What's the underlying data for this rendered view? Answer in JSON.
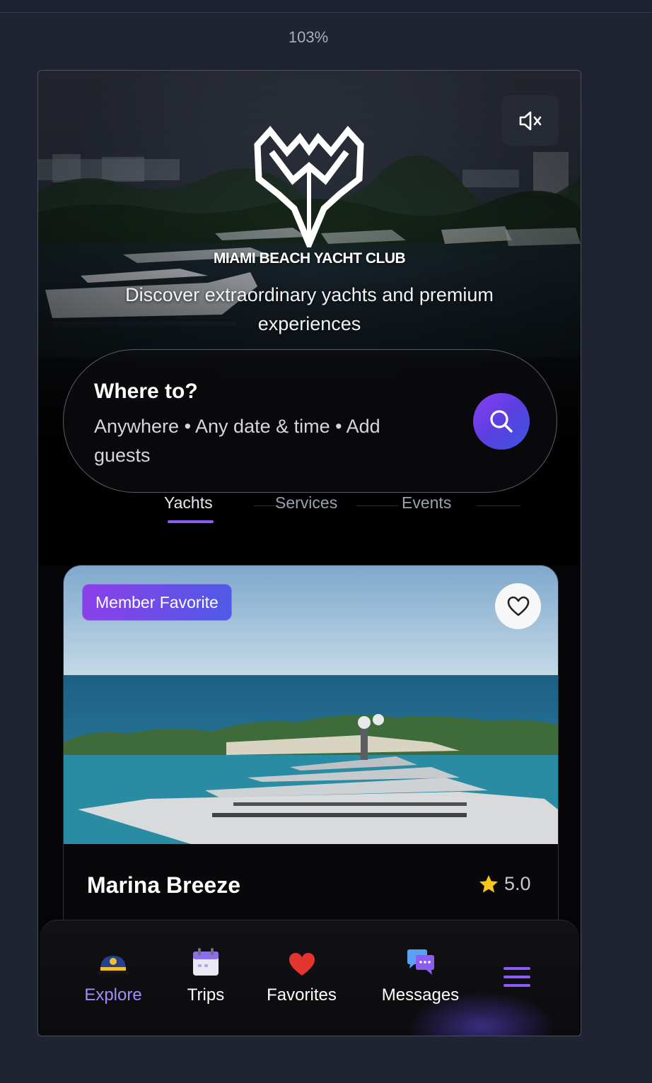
{
  "zoom": "103%",
  "hero": {
    "brand": "MIAMI BEACH YACHT CLUB",
    "tagline": "Discover extraordinary yachts and premium experiences",
    "mute_icon": "speaker-muted-icon"
  },
  "search": {
    "title": "Where to?",
    "subtitle": "Anywhere • Any date & time • Add guests",
    "button_icon": "search-icon"
  },
  "tabs": [
    {
      "label": "Yachts",
      "active": true
    },
    {
      "label": "Services",
      "active": false
    },
    {
      "label": "Events",
      "active": false
    }
  ],
  "listing": {
    "badge": "Member Favorite",
    "name": "Marina Breeze",
    "rating": "5.0",
    "favorite_icon": "heart-outline-icon"
  },
  "nav": [
    {
      "label": "Explore",
      "icon": "captain-hat-icon",
      "active": true
    },
    {
      "label": "Trips",
      "icon": "calendar-icon",
      "active": false
    },
    {
      "label": "Favorites",
      "icon": "heart-icon",
      "active": false
    },
    {
      "label": "Messages",
      "icon": "chat-bubbles-icon",
      "active": false
    }
  ],
  "colors": {
    "accent": "#8b5cf6",
    "background": "#1f2332",
    "search_button": "#6a4af0"
  }
}
